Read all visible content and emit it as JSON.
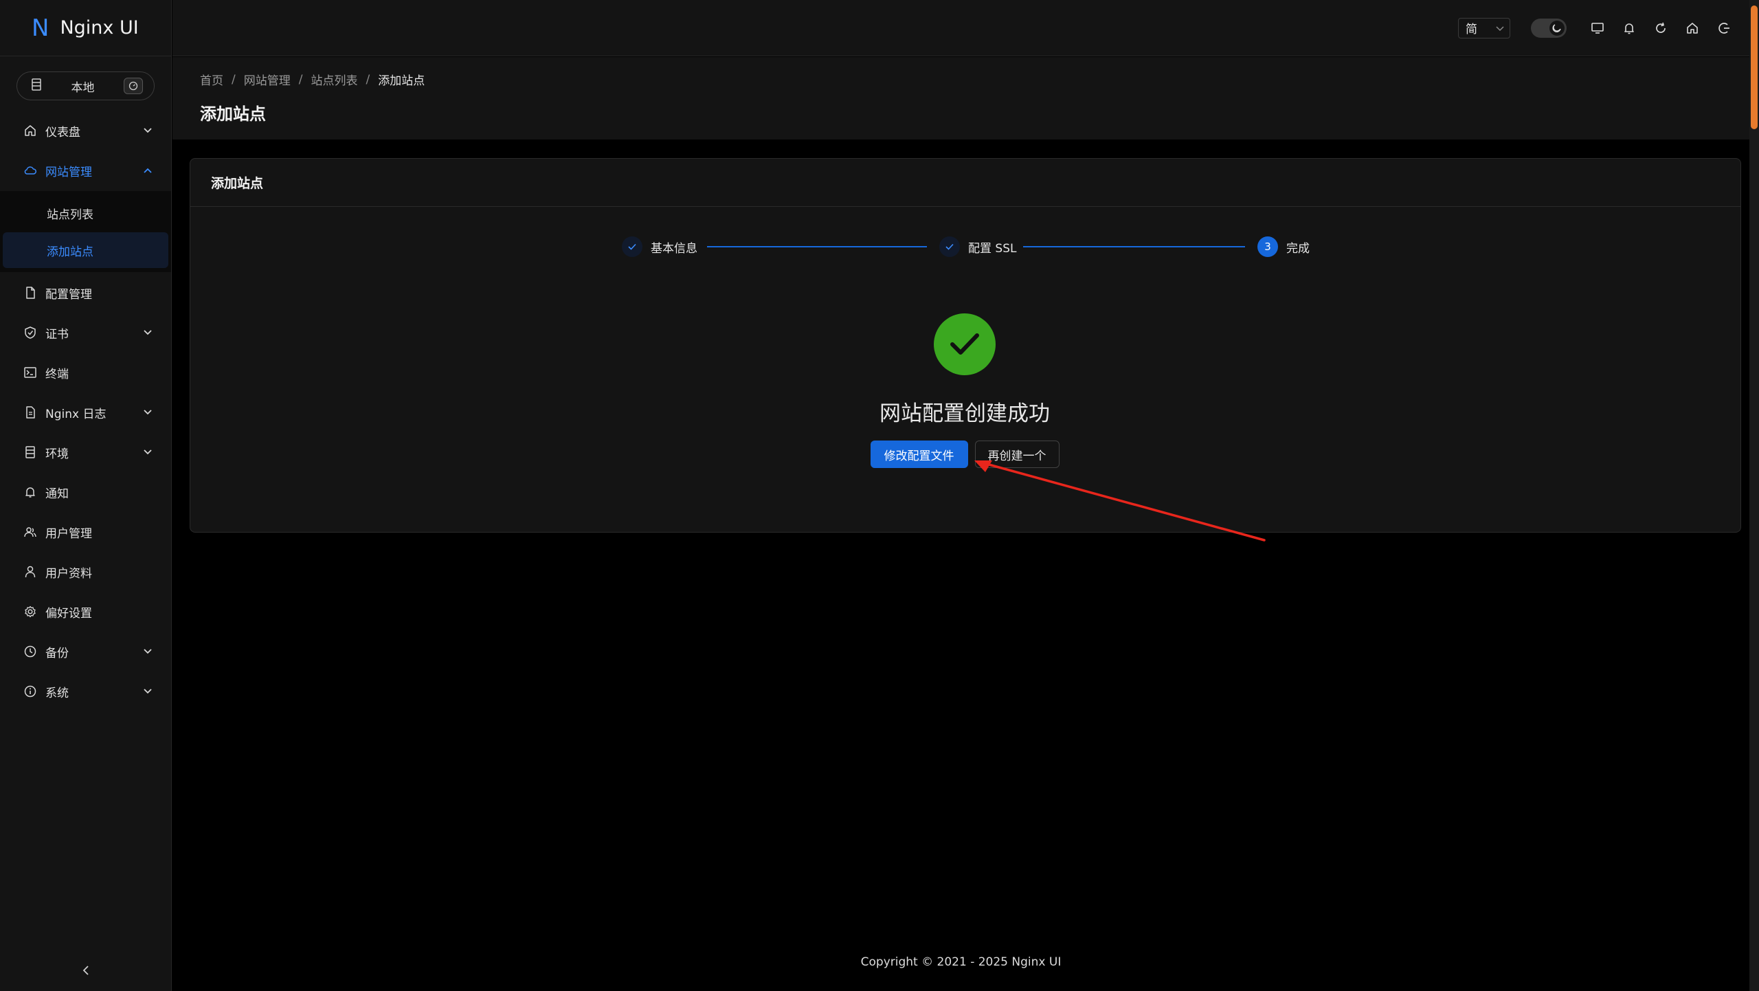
{
  "app": {
    "logo_mark": "N",
    "name": "Nginx UI"
  },
  "env_switch": {
    "label": "本地",
    "icon_left": "server-icon",
    "icon_right": "dashboard-icon"
  },
  "sidebar": {
    "items": [
      {
        "label": "仪表盘",
        "icon": "home-icon",
        "has_arrow": true
      },
      {
        "label": "网站管理",
        "icon": "cloud-icon",
        "has_arrow": true,
        "expanded": true
      },
      {
        "label": "配置管理",
        "icon": "file-icon"
      },
      {
        "label": "证书",
        "icon": "shield-icon",
        "has_arrow": true
      },
      {
        "label": "终端",
        "icon": "terminal-icon"
      },
      {
        "label": "Nginx 日志",
        "icon": "log-icon",
        "has_arrow": true
      },
      {
        "label": "环境",
        "icon": "database-icon",
        "has_arrow": true
      },
      {
        "label": "通知",
        "icon": "bell-icon"
      },
      {
        "label": "用户管理",
        "icon": "users-icon"
      },
      {
        "label": "用户资料",
        "icon": "user-icon"
      },
      {
        "label": "偏好设置",
        "icon": "gear-icon"
      },
      {
        "label": "备份",
        "icon": "clock-icon",
        "has_arrow": true
      },
      {
        "label": "系统",
        "icon": "info-icon",
        "has_arrow": true
      }
    ],
    "submenu": [
      {
        "label": "站点列表",
        "selected": false
      },
      {
        "label": "添加站点",
        "selected": true
      }
    ]
  },
  "header": {
    "language": "简"
  },
  "breadcrumb": {
    "items": [
      "首页",
      "网站管理",
      "站点列表",
      "添加站点"
    ]
  },
  "page": {
    "title": "添加站点"
  },
  "card": {
    "title": "添加站点",
    "steps": [
      {
        "label": "基本信息",
        "status": "finished"
      },
      {
        "label": "配置 SSL",
        "status": "finished"
      },
      {
        "label": "完成",
        "status": "current",
        "number": "3"
      }
    ],
    "result": {
      "title": "网站配置创建成功",
      "primary_button": "修改配置文件",
      "secondary_button": "再创建一个"
    }
  },
  "colors": {
    "accent": "#1668dc",
    "success": "#3ba820",
    "annotation": "#e8261c",
    "scroll_thumb": "#e87b2d"
  },
  "footer": {
    "copyright": "Copyright © 2021 - 2025 Nginx UI"
  }
}
